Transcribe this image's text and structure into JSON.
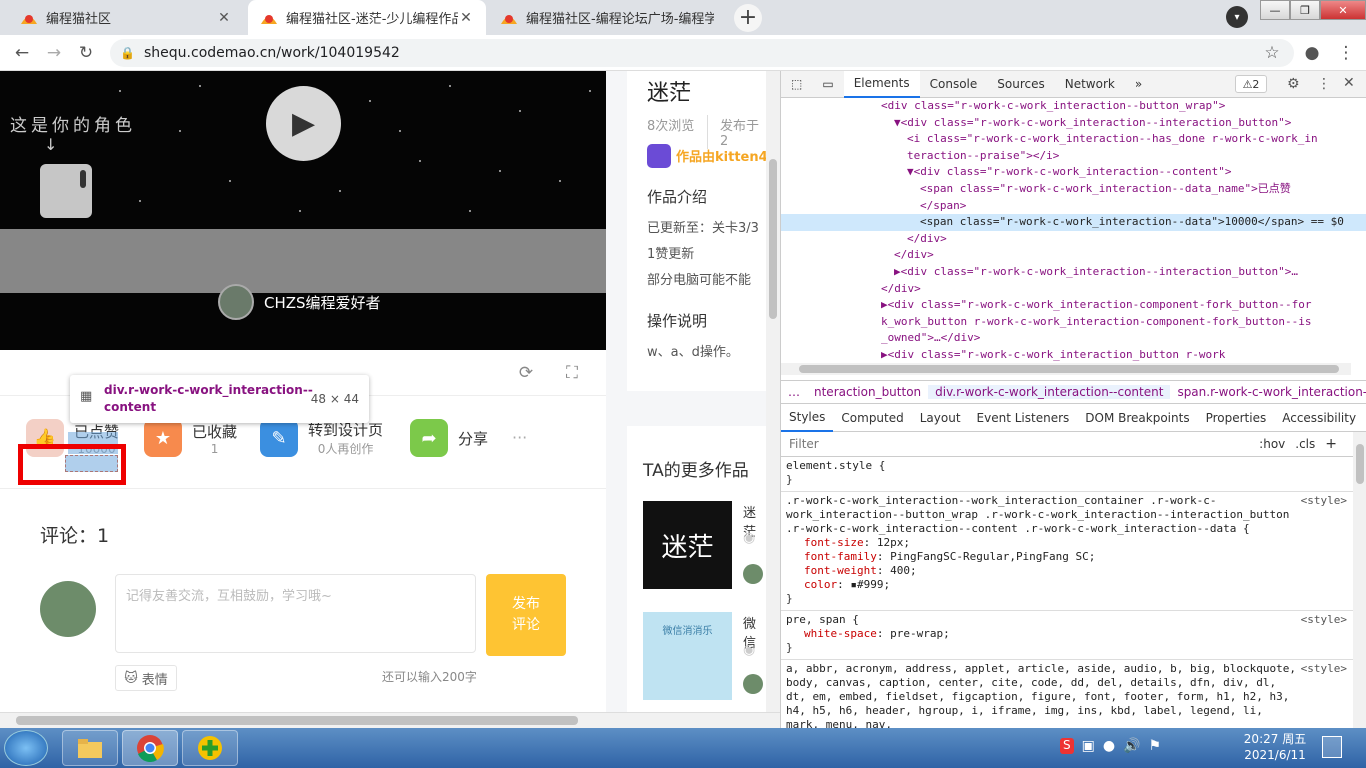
{
  "browser": {
    "tabs": [
      {
        "title": "编程猫社区",
        "close": "✕"
      },
      {
        "title": "编程猫社区-迷茫-少儿编程作品",
        "close": "✕"
      },
      {
        "title": "编程猫社区-编程论坛广场-编程学",
        "close": "✕"
      }
    ],
    "new_tab": "+",
    "url": "shequ.codemao.cn/work/104019542",
    "nav": {
      "back": "←",
      "forward": "→",
      "reload": "↻"
    },
    "window": {
      "min": "—",
      "max": "❐",
      "close": "✕"
    }
  },
  "player": {
    "calligraphy_line1": "这是你的角色",
    "calligraphy_arrow": "↓",
    "play": "▶",
    "author": "CHZS编程爱好者"
  },
  "work": {
    "title": "迷茫",
    "views": "8次浏览",
    "publish": "发布于2",
    "made_by": "作品由kitten4",
    "intro_heading": "作品介绍",
    "intro_lines": [
      "已更新至：关卡3/3",
      "1赞更新",
      "部分电脑可能不能"
    ],
    "ops_heading": "操作说明",
    "ops_text": "w、a、d操作。"
  },
  "actions": {
    "like": {
      "label": "已点赞",
      "count": "10000"
    },
    "fav": {
      "label": "已收藏",
      "count": "1"
    },
    "design": {
      "label": "转到设计页",
      "count": "0人再创作"
    },
    "share": {
      "label": "分享"
    },
    "more": "···"
  },
  "tooltip": {
    "selector": "div.r-work-c-work_interaction--content",
    "size": "48 × 44"
  },
  "comments": {
    "heading": "评论：1",
    "placeholder": "记得友善交流，互相鼓励，学习哦~",
    "submit": "发布\n评论",
    "emoji": "表情",
    "remaining": "还可以输入200字"
  },
  "more_works": {
    "heading": "TA的更多作品",
    "items": [
      {
        "title": "迷茫",
        "thumb_text": "迷茫"
      },
      {
        "title": "微信",
        "thumb_text": "微信消消乐"
      }
    ]
  },
  "devtools": {
    "tabs": [
      "Elements",
      "Console",
      "Sources",
      "Network",
      "»"
    ],
    "warnings": "⚠2",
    "dom_lines": [
      {
        "indent": 8,
        "tag": "<div class=\"r-work-c-work_interaction--button_wrap\">"
      },
      {
        "indent": 9,
        "tag": "▼<div class=\"r-work-c-work_interaction--interaction_button\">"
      },
      {
        "indent": 10,
        "tag": "<i class=\"r-work-c-work_interaction--has_done r-work-c-work_in"
      },
      {
        "indent": 10,
        "tag": "teraction--praise\"></i>"
      },
      {
        "indent": 10,
        "tag": "▼<div class=\"r-work-c-work_interaction--content\">"
      },
      {
        "indent": 11,
        "tag": "<span class=\"r-work-c-work_interaction--data_name\">已点赞"
      },
      {
        "indent": 11,
        "tag": "</span>"
      },
      {
        "indent": 11,
        "tag": "<span class=\"r-work-c-work_interaction--data\">10000</span> == $0",
        "selected": true
      },
      {
        "indent": 10,
        "tag": "</div>"
      },
      {
        "indent": 9,
        "tag": "</div>"
      },
      {
        "indent": 9,
        "tag": "▶<div class=\"r-work-c-work_interaction--interaction_button\">…"
      },
      {
        "indent": 8,
        "tag": "</div>"
      },
      {
        "indent": 8,
        "tag": "▶<div class=\"r-work-c-work_interaction-component-fork_button--for"
      },
      {
        "indent": 8,
        "tag": "k_work_button r-work-c-work_interaction-component-fork_button--is"
      },
      {
        "indent": 8,
        "tag": "_owned\">…</div>"
      },
      {
        "indent": 8,
        "tag": "▶<div class=\"r-work-c-work_interaction_button r-work"
      }
    ],
    "crumbs": [
      "…",
      "nteraction_button",
      "div.r-work-c-work_interaction--content",
      "span.r-work-c-work_interaction--data"
    ],
    "subtabs": [
      "Styles",
      "Computed",
      "Layout",
      "Event Listeners",
      "DOM Breakpoints",
      "Properties",
      "Accessibility"
    ],
    "filter": {
      "placeholder": "Filter",
      "hov": ":hov",
      "cls": ".cls",
      "plus": "+"
    },
    "styles": [
      {
        "selector": "element.style {",
        "src": "",
        "props": [],
        "close": "}"
      },
      {
        "selector": ".r-work-c-work_interaction--work_interaction_container .r-work-c-work_interaction--button_wrap .r-work-c-work_interaction--interaction_button .r-work-c-work_interaction--content .r-work-c-work_interaction--data {",
        "src": "<style>",
        "props": [
          {
            "n": "font-size",
            "v": "12px;"
          },
          {
            "n": "font-family",
            "v": "PingFangSC-Regular,PingFang SC;"
          },
          {
            "n": "font-weight",
            "v": "400;"
          },
          {
            "n": "color",
            "v": "▪#999;"
          }
        ],
        "close": "}"
      },
      {
        "selector": "pre, span {",
        "src": "<style>",
        "props": [
          {
            "n": "white-space",
            "v": "pre-wrap;"
          }
        ],
        "close": "}"
      },
      {
        "selector": "a, abbr, acronym, address, applet, article, aside, audio, b, big, blockquote, body, canvas, caption, center, cite, code, dd, del, details, dfn, div, dl, dt, em, embed, fieldset, figcaption, figure, font, footer, form, h1, h2, h3, h4, h5, h6, header, hgroup, i, iframe, img, ins, kbd, label, legend, li, mark, menu, nav,",
        "src": "<style>",
        "props": [],
        "close": ""
      }
    ]
  },
  "taskbar": {
    "time": "20:27 周五",
    "date": "2021/6/11",
    "tray": [
      "S",
      "🔊",
      "⚑"
    ]
  },
  "colors": {
    "accent": "#1a73e8",
    "highlight_red": "#ee0000",
    "submit_yellow": "#fec433"
  }
}
